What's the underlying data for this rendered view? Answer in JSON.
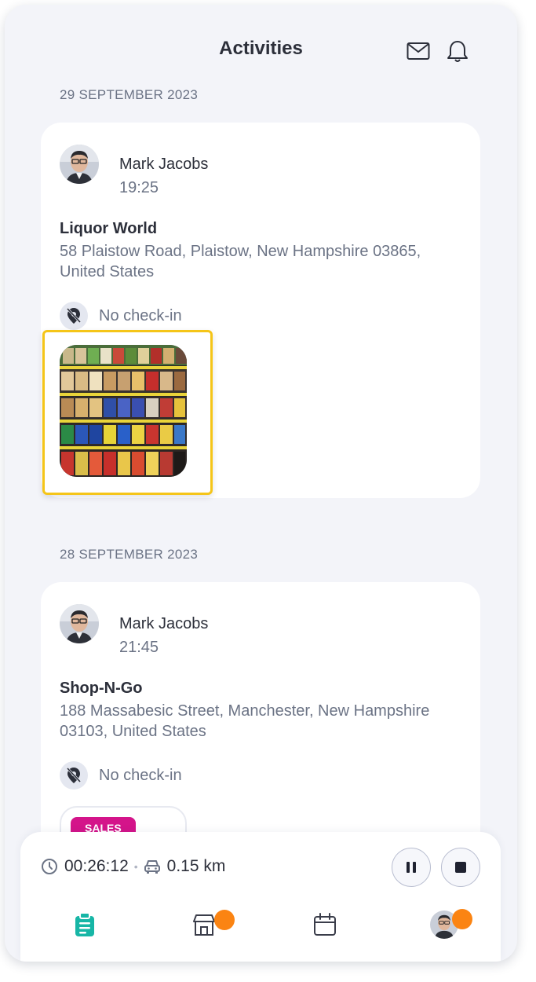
{
  "header": {
    "title": "Activities",
    "icons": [
      "mail-icon",
      "bell-icon"
    ]
  },
  "activities": [
    {
      "date": "29 SEPTEMBER 2023",
      "user_name": "Mark Jacobs",
      "time": "19:25",
      "store_name": "Liquor World",
      "address": "58 Plaistow Road, Plaistow, New Hampshire 03865, United States",
      "checkin_status": "No check-in",
      "photo_icon": "store-shelf-photo"
    },
    {
      "date": "28 SEPTEMBER 2023",
      "user_name": "Mark Jacobs",
      "time": "21:45",
      "store_name": "Shop-N-Go",
      "address": "188 Massabesic Street, Manchester, New Hampshire 03103, United States",
      "checkin_status": "No check-in",
      "tag": "SALES"
    }
  ],
  "tracker": {
    "elapsed": "00:26:12",
    "distance": "0.15 km"
  },
  "nav": {
    "items": [
      "activities-icon",
      "store-icon",
      "calendar-icon",
      "profile-avatar"
    ]
  },
  "colors": {
    "accent": "#17b6a6",
    "badge": "#fb8412",
    "highlight": "#f5c518",
    "tag": "#d4148a"
  }
}
